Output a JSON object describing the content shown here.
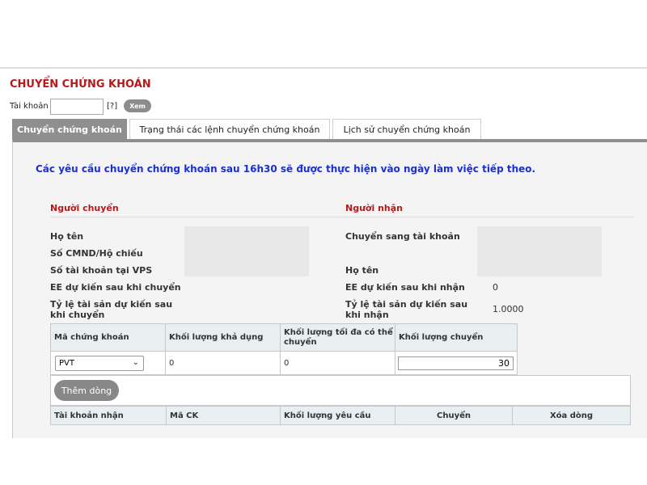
{
  "page": {
    "title": "CHUYỂN CHỨNG KHOÁN",
    "account_label": "Tài khoản",
    "account_value": "",
    "help_text": "[?]",
    "view_button": "Xem"
  },
  "tabs": [
    {
      "label": "Chuyển chứng khoán",
      "active": true
    },
    {
      "label": "Trạng thái các lệnh chuyển chứng khoán",
      "active": false
    },
    {
      "label": "Lịch sử chuyển chứng khoán",
      "active": false
    }
  ],
  "notice": "Các yêu cầu chuyển chứng khoán sau 16h30 sẽ được thực hiện vào ngày làm việc tiếp theo.",
  "sender": {
    "heading": "Người chuyển",
    "name_label": "Họ tên",
    "id_label": "Số CMND/Hộ chiếu",
    "vps_account_label": "Số tài khoản tại VPS",
    "ee_label": "EE dự kiến sau khi chuyển",
    "ratio_label": "Tỷ lệ tài sản dự kiến sau khi chuyển"
  },
  "receiver": {
    "heading": "Người nhận",
    "to_account_label": "Chuyển sang tài khoản",
    "name_label": "Họ tên",
    "ee_label": "EE dự kiến sau khi nhận",
    "ee_value": "0",
    "ratio_label": "Tỷ lệ tài sản dự kiến sau khi nhận",
    "ratio_value": "1.0000"
  },
  "transfer_table": {
    "headers": [
      "Mã chứng khoán",
      "Khối lượng khả dụng",
      "Khối lượng tối đa có thể chuyển",
      "Khối lượng chuyển"
    ],
    "row": {
      "symbol": "PVT",
      "available": "0",
      "max_transfer": "0",
      "quantity": "30"
    }
  },
  "add_row_button": "Thêm dòng",
  "summary_table": {
    "headers": [
      "Tài khoản nhận",
      "Mã CK",
      "Khối lượng yêu cầu",
      "Chuyển",
      "Xóa dòng"
    ]
  },
  "colors": {
    "title_red": "#b81818",
    "notice_blue": "#1b2fd6",
    "tab_active": "#8f8f8f",
    "table_header": "#e8eff0"
  }
}
